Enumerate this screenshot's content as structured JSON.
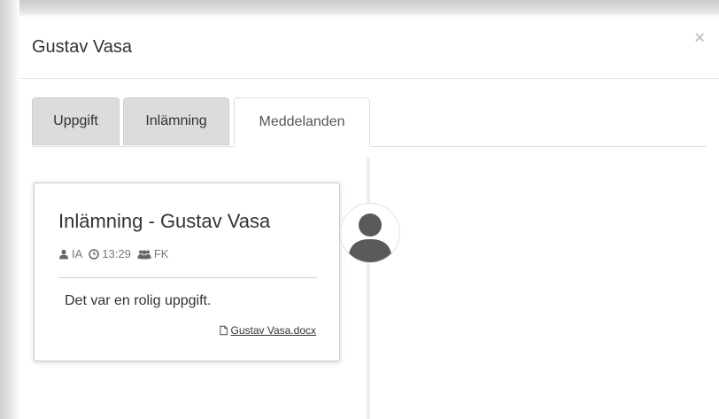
{
  "modal": {
    "title": "Gustav Vasa",
    "close_label": "×"
  },
  "tabs": [
    {
      "label": "Uppgift",
      "active": false
    },
    {
      "label": "Inlämning",
      "active": false
    },
    {
      "label": "Meddelanden",
      "active": true
    }
  ],
  "message": {
    "title": "Inlämning - Gustav Vasa",
    "author": "IA",
    "time": "13:29",
    "group": "FK",
    "body": "Det var en rolig uppgift.",
    "attachment": "Gustav Vasa.docx",
    "icons": {
      "author": "user-icon",
      "time": "clock-icon",
      "group": "users-icon",
      "attachment": "file-icon",
      "avatar": "user-avatar-icon"
    }
  },
  "colors": {
    "tab_inactive_bg": "#dcdcdc",
    "text": "#333333",
    "meta_text": "#777777",
    "close": "#c8c8c8",
    "avatar_fill": "#5a5a5a"
  }
}
